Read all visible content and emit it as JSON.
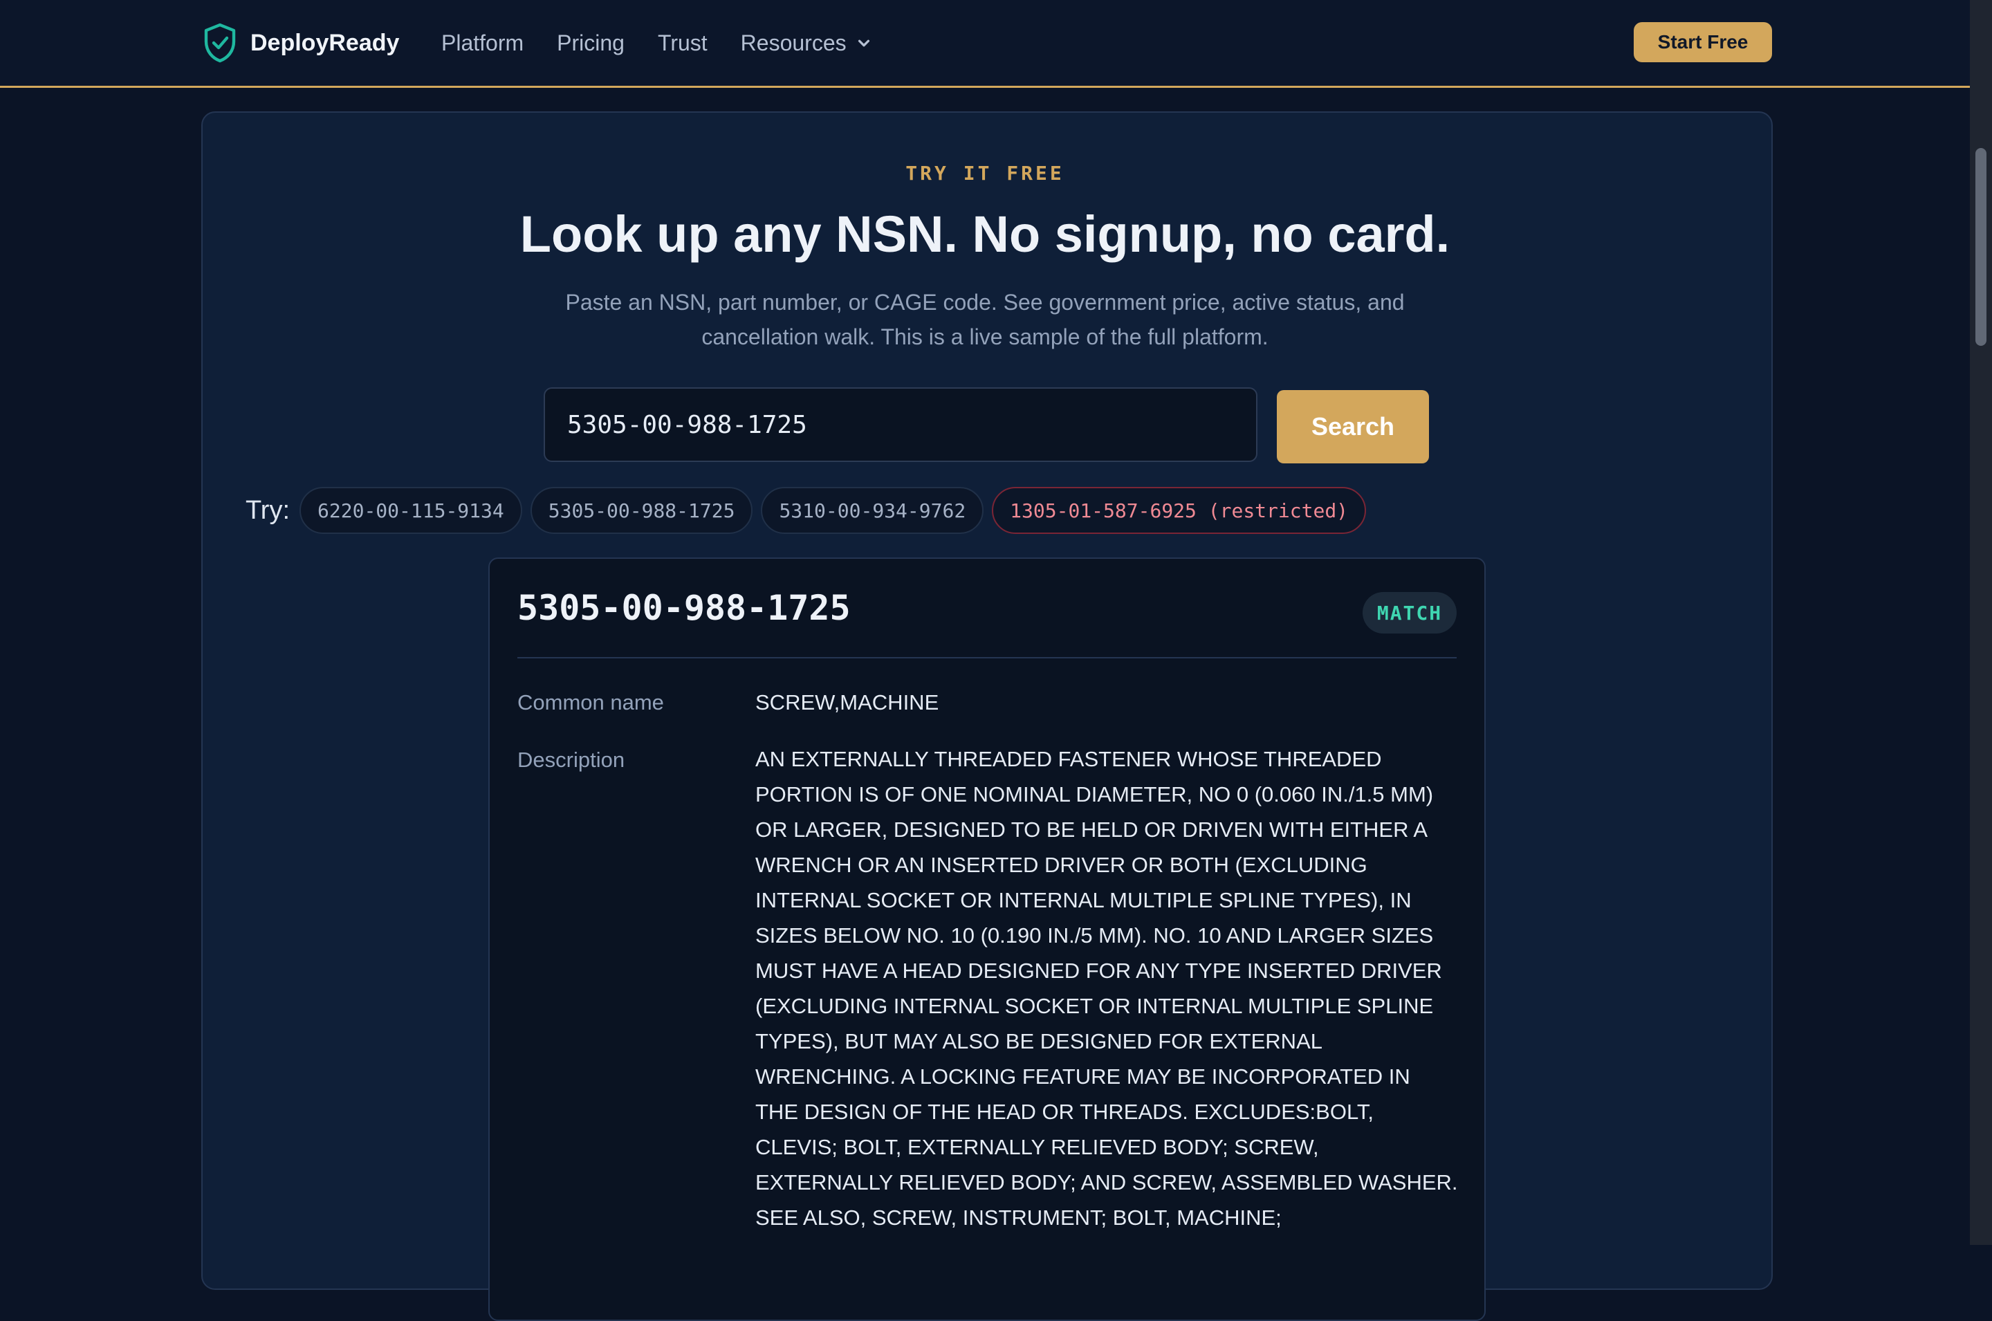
{
  "brand": {
    "name": "DeployReady",
    "accent": "#d3a75c",
    "logo_color": "#1fb8a0"
  },
  "nav": {
    "items": [
      {
        "label": "Platform"
      },
      {
        "label": "Pricing"
      },
      {
        "label": "Trust"
      },
      {
        "label": "Resources",
        "has_dropdown": true
      }
    ],
    "cta_label": "Start Free"
  },
  "hero": {
    "eyebrow": "TRY IT FREE",
    "title": "Look up any NSN. No signup, no card.",
    "subtitle": "Paste an NSN, part number, or CAGE code. See government price, active status, and cancellation walk. This is a live sample of the full platform."
  },
  "search": {
    "value": "5305-00-988-1725",
    "button_label": "Search"
  },
  "try": {
    "label": "Try:",
    "chips": [
      {
        "label": "6220-00-115-9134",
        "restricted": false
      },
      {
        "label": "5305-00-988-1725",
        "restricted": false
      },
      {
        "label": "5310-00-934-9762",
        "restricted": false
      },
      {
        "label": "1305-01-587-6925 (restricted)",
        "restricted": true
      }
    ]
  },
  "result": {
    "nsn": "5305-00-988-1725",
    "badge": "MATCH",
    "badge_color": "#3fd6b1",
    "fields": {
      "common_name_label": "Common name",
      "common_name": "SCREW,MACHINE",
      "description_label": "Description",
      "description": "AN EXTERNALLY THREADED FASTENER WHOSE THREADED PORTION IS OF ONE NOMINAL DIAMETER, NO 0 (0.060 IN./1.5 MM) OR LARGER, DESIGNED TO BE HELD OR DRIVEN WITH EITHER A WRENCH OR AN INSERTED DRIVER OR BOTH (EXCLUDING INTERNAL SOCKET OR INTERNAL MULTIPLE SPLINE TYPES), IN SIZES BELOW NO. 10 (0.190 IN./5 MM). NO. 10 AND LARGER SIZES MUST HAVE A HEAD DESIGNED FOR ANY TYPE INSERTED DRIVER (EXCLUDING INTERNAL SOCKET OR INTERNAL MULTIPLE SPLINE TYPES), BUT MAY ALSO BE DESIGNED FOR EXTERNAL WRENCHING. A LOCKING FEATURE MAY BE INCORPORATED IN THE DESIGN OF THE HEAD OR THREADS. EXCLUDES:BOLT, CLEVIS; BOLT, EXTERNALLY RELIEVED BODY; SCREW, EXTERNALLY RELIEVED BODY; AND SCREW, ASSEMBLED WASHER. SEE ALSO, SCREW, INSTRUMENT; BOLT, MACHINE;"
    }
  }
}
